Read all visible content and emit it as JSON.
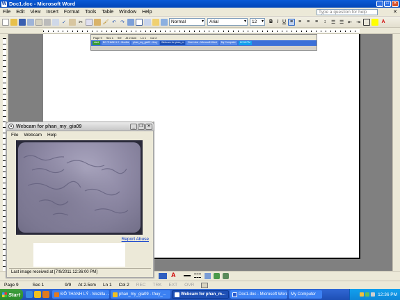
{
  "word": {
    "title": "Doc1.doc - Microsoft Word",
    "menu": [
      "File",
      "Edit",
      "View",
      "Insert",
      "Format",
      "Tools",
      "Table",
      "Window",
      "Help"
    ],
    "help_placeholder": "Type a question for help",
    "style": "Normal",
    "font": "Arial",
    "font_size": "12",
    "bold": "B",
    "italic": "I",
    "underline": "U",
    "status": {
      "page": "Page 9",
      "sec": "Sec 1",
      "pages": "9/9",
      "at": "At 2.5cm",
      "ln": "Ln 1",
      "col": "Col 2",
      "rec": "REC",
      "trk": "TRK",
      "ext": "EXT",
      "ovr": "OVR"
    }
  },
  "webcam": {
    "title": "Webcam for phan_my_gia09",
    "menu": [
      "File",
      "Webcam",
      "Help"
    ],
    "report_abuse": "Report Abuse",
    "last_image": "Last image received at [7/9/2011 12:36:00 PM]"
  },
  "taskbar": {
    "start": "Start",
    "tasks": [
      {
        "label": "ĐỖ THANH LÝ - Mozilla ...",
        "active": false
      },
      {
        "label": "phan_my_gia09 - thuy_...",
        "active": false
      },
      {
        "label": "Webcam for phan_m...",
        "active": true
      },
      {
        "label": "Doc1.doc - Microsoft Word",
        "active": false
      },
      {
        "label": "My Computer",
        "active": false
      }
    ],
    "clock": "12:36 PM"
  }
}
